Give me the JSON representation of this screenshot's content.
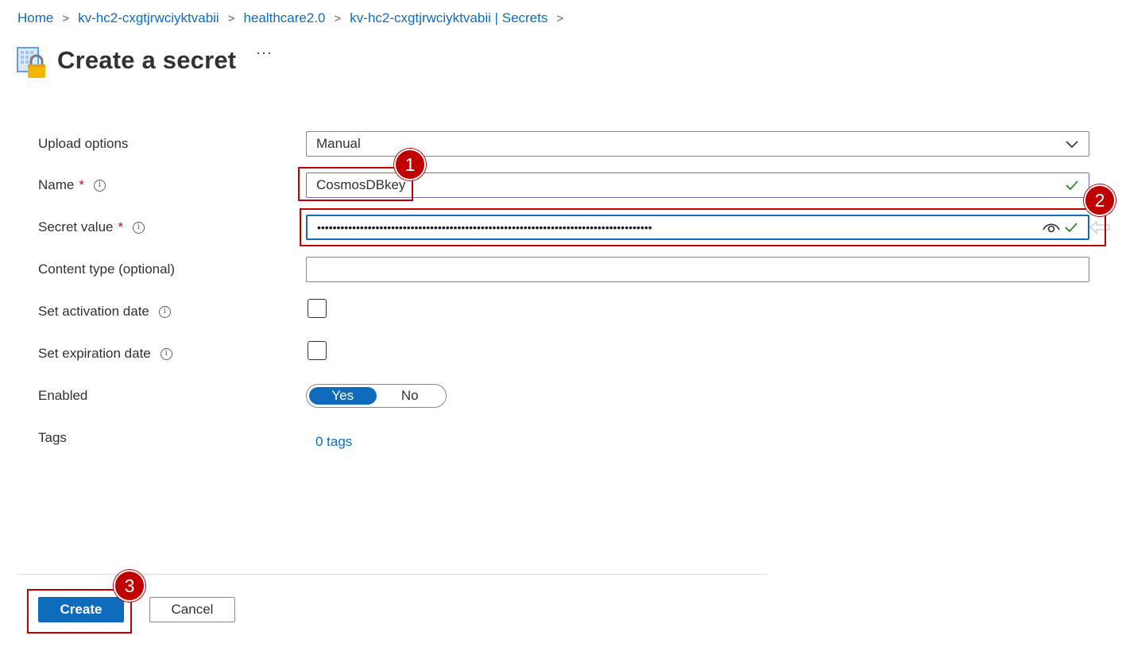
{
  "breadcrumb": {
    "items": [
      "Home",
      "kv-hc2-cxgtjrwciyktvabii",
      "healthcare2.0",
      "kv-hc2-cxgtjrwciyktvabii | Secrets"
    ],
    "separator": ">"
  },
  "page": {
    "title": "Create a secret",
    "more": "···"
  },
  "form": {
    "upload_options": {
      "label": "Upload options",
      "value": "Manual"
    },
    "name": {
      "label": "Name",
      "required_mark": "*",
      "info": "i",
      "value": "CosmosDBkey"
    },
    "secret_value": {
      "label": "Secret value",
      "required_mark": "*",
      "info": "i",
      "masked": "••••••••••••••••••••••••••••••••••••••••••••••••••••••••••••••••••••••••••••••••••••••"
    },
    "content_type": {
      "label": "Content type (optional)",
      "value": ""
    },
    "activation": {
      "label": "Set activation date",
      "info": "i"
    },
    "expiration": {
      "label": "Set expiration date",
      "info": "i"
    },
    "enabled": {
      "label": "Enabled",
      "yes": "Yes",
      "no": "No",
      "selected": "Yes"
    },
    "tags": {
      "label": "Tags",
      "link": "0 tags"
    }
  },
  "footer": {
    "create_label": "Create",
    "cancel_label": "Cancel"
  },
  "annotations": {
    "step1": "1",
    "step2": "2",
    "step3": "3"
  },
  "colors": {
    "accent": "#0f6cbd",
    "valid": "#107c10",
    "annotation": "#c00000"
  },
  "icons": [
    "key-vault-secret-icon",
    "chevron-right-icon",
    "chevron-down-icon",
    "info-icon",
    "eye-icon",
    "checkmark-icon",
    "arrow-left-icon"
  ]
}
